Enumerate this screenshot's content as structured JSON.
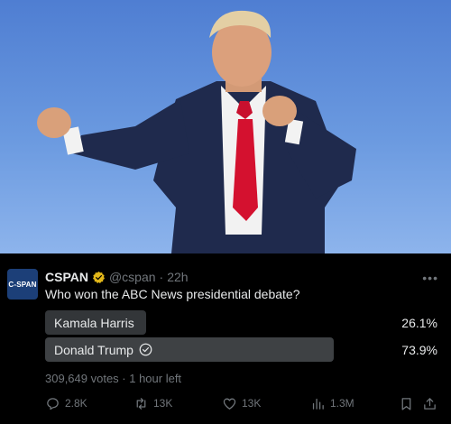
{
  "photo": {
    "description_icon": "person-photo"
  },
  "tweet": {
    "avatar_text": "C-SPAN",
    "name": "CSPAN",
    "handle": "@cspan",
    "separator": "·",
    "time": "22h",
    "question": "Who won the ABC News presidential debate?",
    "poll": {
      "options": [
        {
          "label": "Kamala Harris",
          "percent_text": "26.1%",
          "percent": 26.1,
          "winner": false
        },
        {
          "label": "Donald Trump",
          "percent_text": "73.9%",
          "percent": 73.9,
          "winner": true
        }
      ],
      "meta": "309,649 votes · 1 hour left"
    },
    "actions": {
      "replies": "2.8K",
      "reposts": "13K",
      "likes": "13K",
      "views": "1.3M"
    },
    "colors": {
      "verified": "#e2b719",
      "muted": "#71767b",
      "bar_loser": "#333639",
      "bar_winner": "#3e4144"
    }
  }
}
